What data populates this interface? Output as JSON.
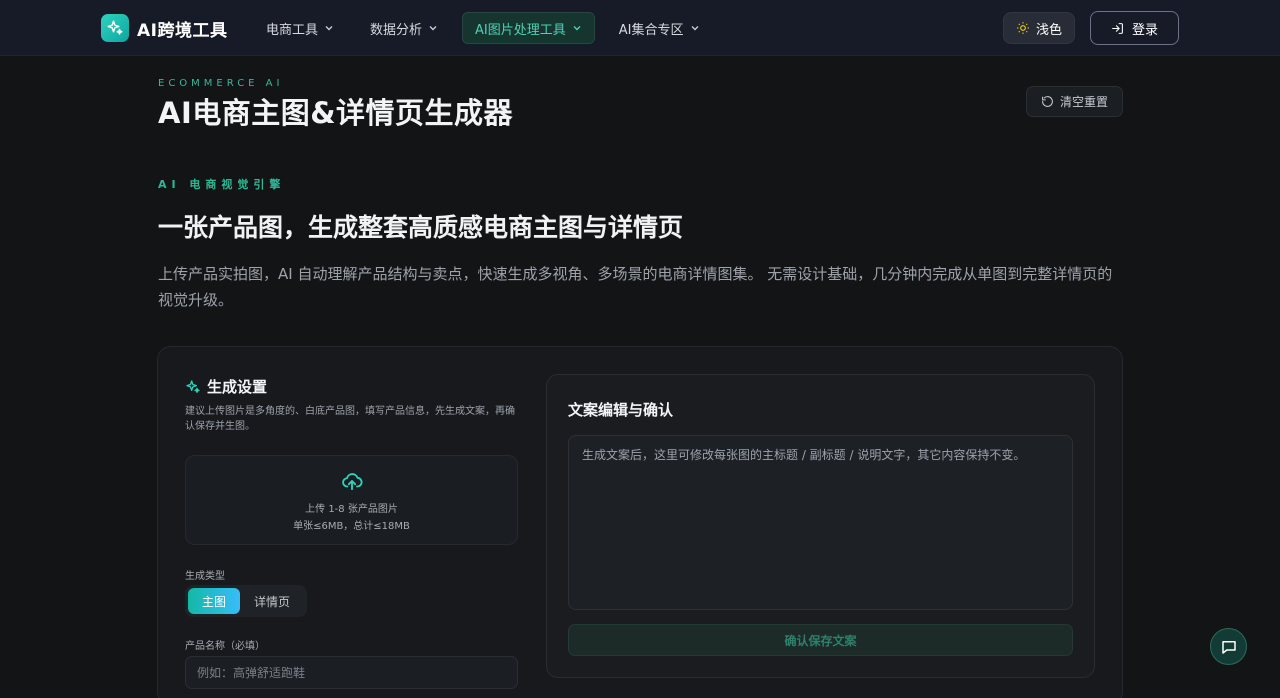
{
  "nav": {
    "logo_text": "AI跨境工具",
    "menu": [
      {
        "label": "电商工具",
        "active": false
      },
      {
        "label": "数据分析",
        "active": false
      },
      {
        "label": "AI图片处理工具",
        "active": true
      },
      {
        "label": "AI集合专区",
        "active": false
      }
    ],
    "theme_label": "浅色",
    "login_label": "登录"
  },
  "header": {
    "eyebrow": "ECOMMERCE AI",
    "title": "AI电商主图&详情页生成器",
    "reset_label": "清空重置"
  },
  "intro": {
    "tag": "AI 电商视觉引擎",
    "headline": "一张产品图，生成整套高质感电商主图与详情页",
    "description": "上传产品实拍图，AI 自动理解产品结构与卖点，快速生成多视角、多场景的电商详情图集。 无需设计基础，几分钟内完成从单图到完整详情页的视觉升级。"
  },
  "settings": {
    "title": "生成设置",
    "hint": "建议上传图片是多角度的、白底产品图，填写产品信息，先生成文案，再确认保存并生图。",
    "upload_line1": "上传 1-8 张产品图片",
    "upload_line2": "单张≤6MB，总计≤18MB",
    "type_label": "生成类型",
    "type_options": [
      "主图",
      "详情页"
    ],
    "type_selected": "主图",
    "name_label": "产品名称（必填）",
    "name_placeholder": "例如：高弹舒适跑鞋"
  },
  "copy_panel": {
    "title": "文案编辑与确认",
    "placeholder": "生成文案后，这里可修改每张图的主标题 / 副标题 / 说明文字，其它内容保持不变。",
    "save_label": "确认保存文案"
  },
  "colors": {
    "accent": "#2dd4bf",
    "background": "#131416",
    "nav_background": "#161b27"
  },
  "icons": [
    "sparkle-icon",
    "chevron-down-icon",
    "sun-icon",
    "login-icon",
    "reset-icon",
    "upload-cloud-icon",
    "chat-icon"
  ]
}
